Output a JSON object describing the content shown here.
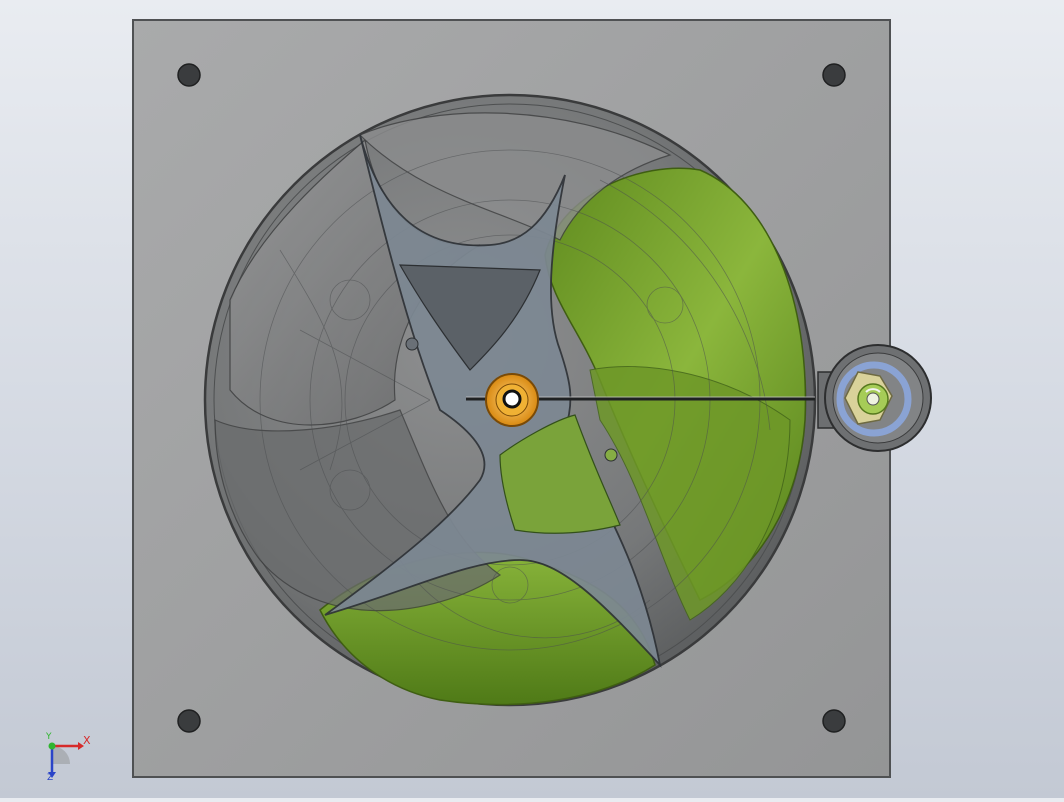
{
  "viewport": {
    "colors": {
      "background_top": "#e9ecf1",
      "background_bottom": "#c3c9d4",
      "plate": "#9d9e9e",
      "plate_edge": "#5a5c5e",
      "housing_gray": "#6f7173",
      "housing_green": "#6f9a2a",
      "rotor": "#7a8691",
      "hub": "#e8a221",
      "knob_ring": "#7f9bcf",
      "knob_center": "#9bc24a"
    }
  },
  "triad": {
    "x_label": "X",
    "y_label": "Y",
    "z_label": "Z",
    "x_color": "#d62a2a",
    "y_color": "#2fb52f",
    "z_color": "#2a44c8"
  }
}
